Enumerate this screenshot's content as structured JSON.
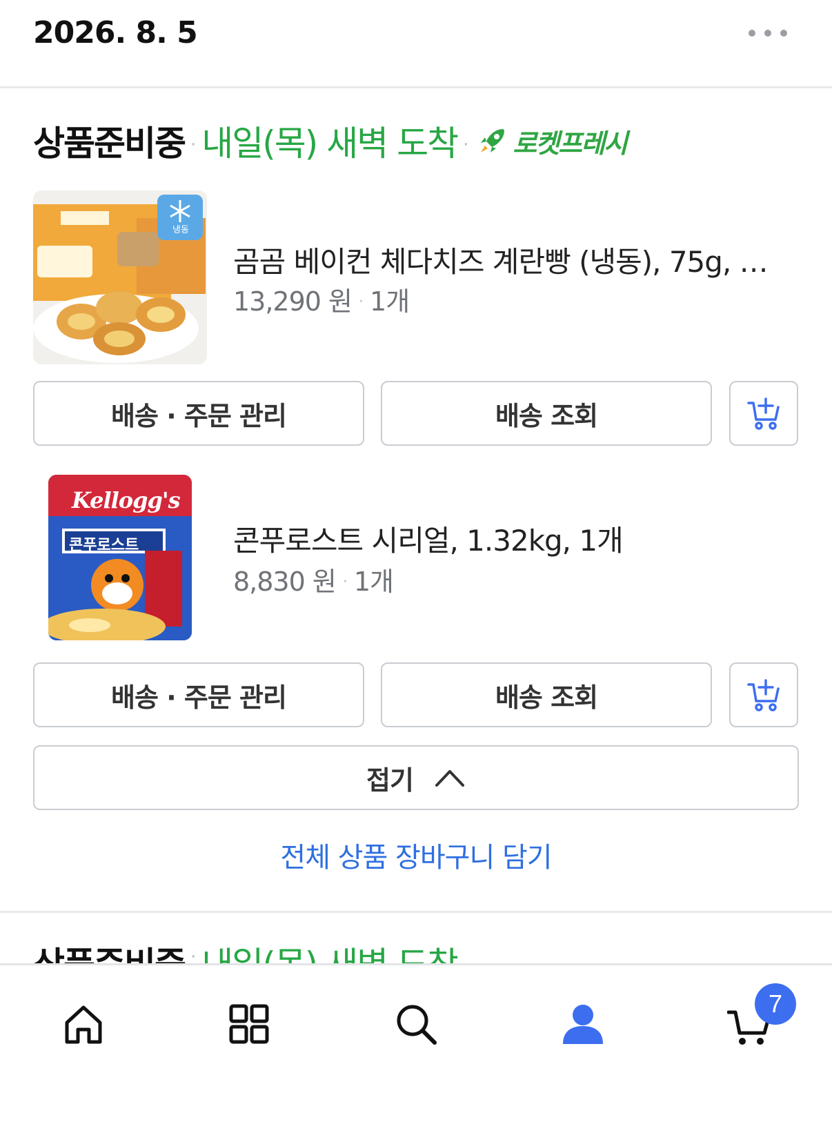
{
  "header": {
    "date": "2026. 8. 5",
    "more_icon": "more-horizontal-icon"
  },
  "order": {
    "status": "상품준비중",
    "arrival": "내일(목) 새벽 도착",
    "delivery_badge": "로켓프레시",
    "badge_color": "#2fa642",
    "arrival_color": "#27a745"
  },
  "items": [
    {
      "name": "곰곰 베이컨 체다치즈 계란빵 (냉동), 75g, …",
      "price": "13,290 원",
      "qty": "1개",
      "thumb_label": "냉동",
      "manage_label": "배송 · 주문 관리",
      "track_label": "배송 조회",
      "cart_icon": "add-to-cart-icon"
    },
    {
      "name": "콘푸로스트 시리얼, 1.32kg, 1개",
      "price": "8,830 원",
      "qty": "1개",
      "thumb_brand": "Kellogg's",
      "thumb_product": "콘푸로스트",
      "manage_label": "배송 · 주문 관리",
      "track_label": "배송 조회",
      "cart_icon": "add-to-cart-icon"
    }
  ],
  "collapse_label": "접기",
  "add_all_label": "전체 상품 장바구니 담기",
  "add_all_color": "#2f6fe0",
  "next_order": {
    "status": "상품준비중",
    "arrival": "내일(목) 새벽 도착"
  },
  "bottom_nav": {
    "items": [
      "home-icon",
      "categories-icon",
      "search-icon",
      "my-account-icon",
      "cart-icon"
    ],
    "cart_badge": "7",
    "active_color": "#3d6ef0"
  }
}
